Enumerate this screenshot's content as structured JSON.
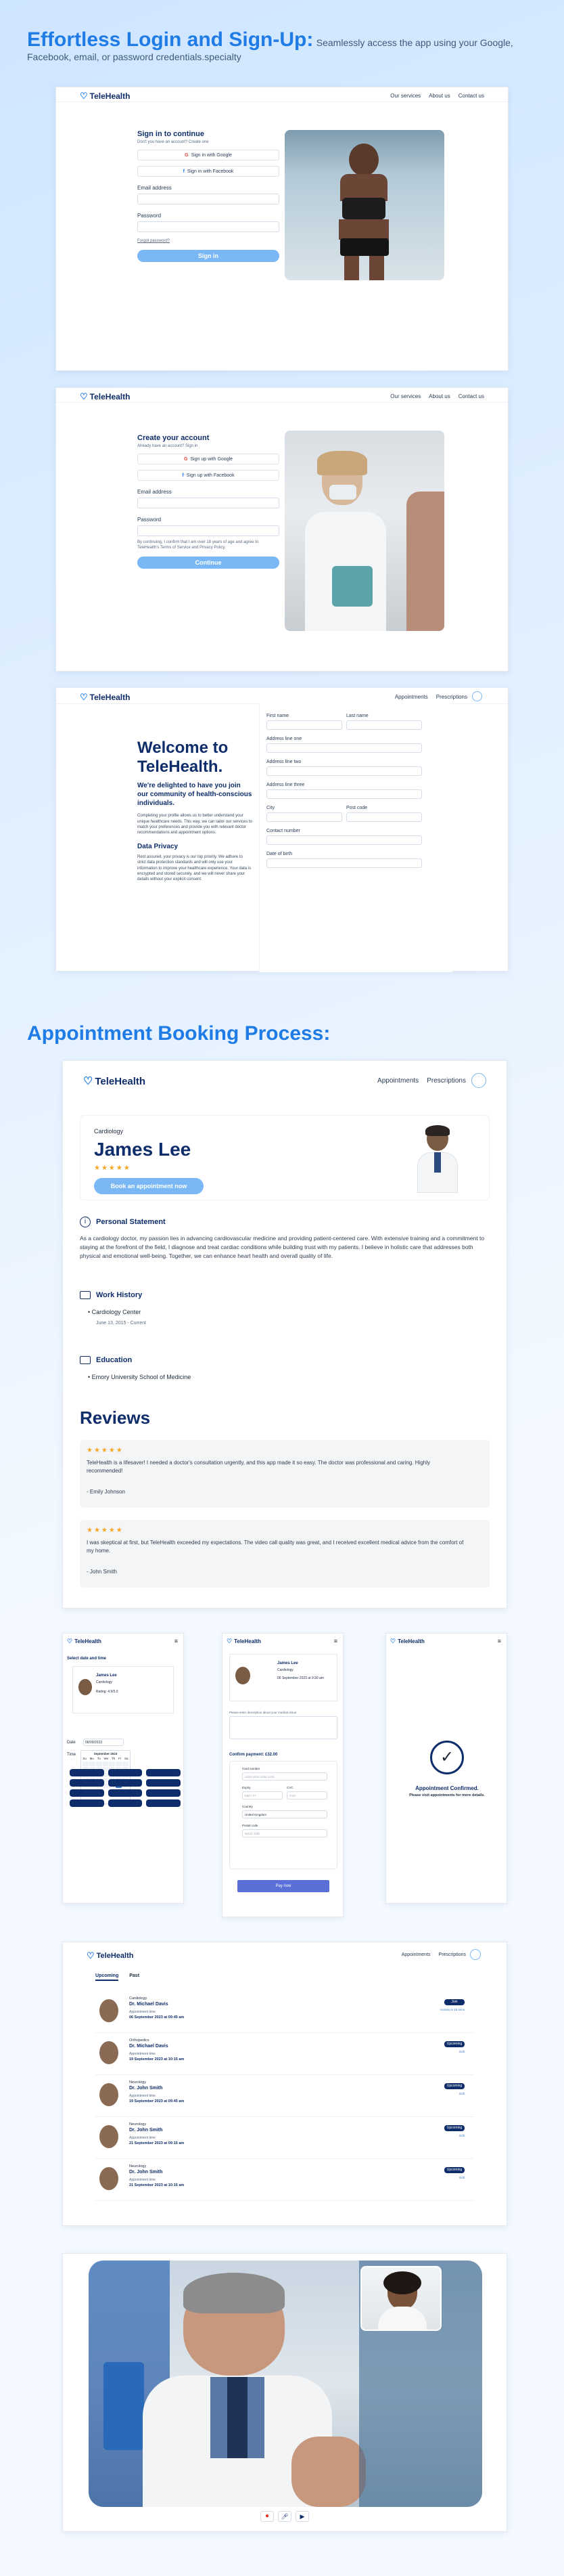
{
  "header": {
    "title": "Effortless Login and Sign-Up:",
    "subtitle": "Seamlessly access the app using your Google, Facebook, email, or password credentials.specialty"
  },
  "brand": "TeleHealth",
  "nav": {
    "services": "Our services",
    "about": "About us",
    "contact": "Contact us"
  },
  "signin": {
    "title": "Sign in to continue",
    "prompt": "Don't you have an account? Create one",
    "google": "Sign in with Google",
    "facebook": "Sign in with Facebook",
    "email_label": "Email address",
    "password_label": "Password",
    "forgot": "Forgot password?",
    "submit": "Sign in"
  },
  "signup": {
    "title": "Create your account",
    "prompt": "Already have an account? Sign in",
    "google": "Sign up with Google",
    "facebook": "Sign up with Facebook",
    "email_label": "Email address",
    "password_label": "Password",
    "terms": "By continuing, I confirm that I am over 18 years of age and agree to TeleHealth's Terms of Service and Privacy Policy.",
    "submit": "Continue"
  },
  "welcome": {
    "nav_appointments": "Appointments",
    "nav_prescriptions": "Prescriptions",
    "title": "Welcome to TeleHealth.",
    "tagline": "We're delighted to have you join our community of health-conscious individuals.",
    "body": "Completing your profile allows us to better understand your unique healthcare needs. This way, we can tailor our services to match your preferences and provide you with relevant doctor recommendations and appointment options.",
    "privacy_title": "Data Privacy",
    "privacy_body": "Rest assured, your privacy is our top priority. We adhere to strict data protection standards and will only use your information to improve your healthcare experience. Your data is encrypted and stored securely, and we will never share your details without your explicit consent.",
    "first_name": "First name",
    "last_name": "Last name",
    "address1": "Address line one",
    "address2": "Address line two",
    "address3": "Address line three",
    "city": "City",
    "postcode": "Post code",
    "contact": "Contact number",
    "dob": "Date of birth"
  },
  "booking": {
    "title": "Appointment Booking Process:",
    "specialty": "Cardiology",
    "doctor": "James Lee",
    "rating_stars": "★★★★★",
    "book_button": "Book an appointment now",
    "statement_title": "Personal Statement",
    "statement_body": "As a cardiology doctor, my passion lies in advancing cardiovascular medicine and providing patient-centered care. With extensive training and a commitment to staying at the forefront of the field, I diagnose and treat cardiac conditions while building trust with my patients. I believe in holistic care that addresses both physical and emotional well-being. Together, we can enhance heart health and overall quality of life.",
    "work_title": "Work History",
    "work_place": "Cardiology Center",
    "work_dates": "June 13, 2015 - Current",
    "edu_title": "Education",
    "edu_place": "Emory University School of Medicine",
    "reviews_title": "Reviews",
    "reviews": [
      {
        "stars": "★★★★★",
        "text": "TeleHealth is a lifesaver! I needed a doctor's consultation urgently, and this app made it so easy. The doctor was professional and caring. Highly recommended!",
        "author": "- Emily Johnson"
      },
      {
        "stars": "★★★★★",
        "text": "I was skeptical at first, but TeleHealth exceeded my expectations. The video call quality was great, and I received excellent medical advice from the comfort of my home.",
        "author": "- John Smith"
      }
    ]
  },
  "mobile": {
    "select_title": "Select date and time",
    "doctor": "James Lee",
    "specialty": "Cardiology",
    "rating": "Rating: 4.9/5.0",
    "date_label": "Date",
    "date_value": "06/09/2023",
    "time_label": "Time",
    "month": "September 2023",
    "weekdays": [
      "Su",
      "Mo",
      "Tu",
      "We",
      "Th",
      "Fr",
      "Sa"
    ],
    "confirm_datetime": "06 September 2023 at 9:30 am",
    "concern_label": "Please enter description about your medical issue",
    "payment_title": "Confirm payment: £32.00",
    "card_number": "Card number",
    "card_placeholder": "1234 1234 1234 1234",
    "expiry": "Expiry",
    "expiry_placeholder": "MM / YY",
    "cvc": "CVC",
    "cvc_placeholder": "CVC",
    "country": "Country",
    "country_value": "United Kingdom",
    "postal": "Postal code",
    "postal_placeholder": "WS11 1DB",
    "pay_button": "Pay now",
    "confirmed_title": "Appointment Confirmed.",
    "confirmed_body": "Please visit appointments for more details."
  },
  "appointments": {
    "tab_upcoming": "Upcoming",
    "tab_past": "Past",
    "items": [
      {
        "specialty": "Cardiology",
        "doctor": "Dr. Michael Davis",
        "time_label": "Appointment time",
        "time": "06 September 2023 at 09:45 am",
        "badge": "Join",
        "note": "Access in 15 mins"
      },
      {
        "specialty": "Orthopedics",
        "doctor": "Dr. Michael Davis",
        "time_label": "Appointment time",
        "time": "19 September 2023 at 10:15 am",
        "badge": "Upcoming",
        "note": "Edit"
      },
      {
        "specialty": "Neurology",
        "doctor": "Dr. John Smith",
        "time_label": "Appointment time",
        "time": "19 September 2023 at 09:45 am",
        "badge": "Upcoming",
        "note": "Edit"
      },
      {
        "specialty": "Neurology",
        "doctor": "Dr. John Smith",
        "time_label": "Appointment time",
        "time": "21 September 2023 at 09:15 am",
        "badge": "Upcoming",
        "note": "Edit"
      },
      {
        "specialty": "Neurology",
        "doctor": "Dr. John Smith",
        "time_label": "Appointment time",
        "time": "21 September 2023 at 10:15 am",
        "badge": "Upcoming",
        "note": "Edit"
      }
    ]
  },
  "colors": {
    "accent": "#1f7be6",
    "navy": "#0f2d6a",
    "button": "#7ab8f5"
  }
}
